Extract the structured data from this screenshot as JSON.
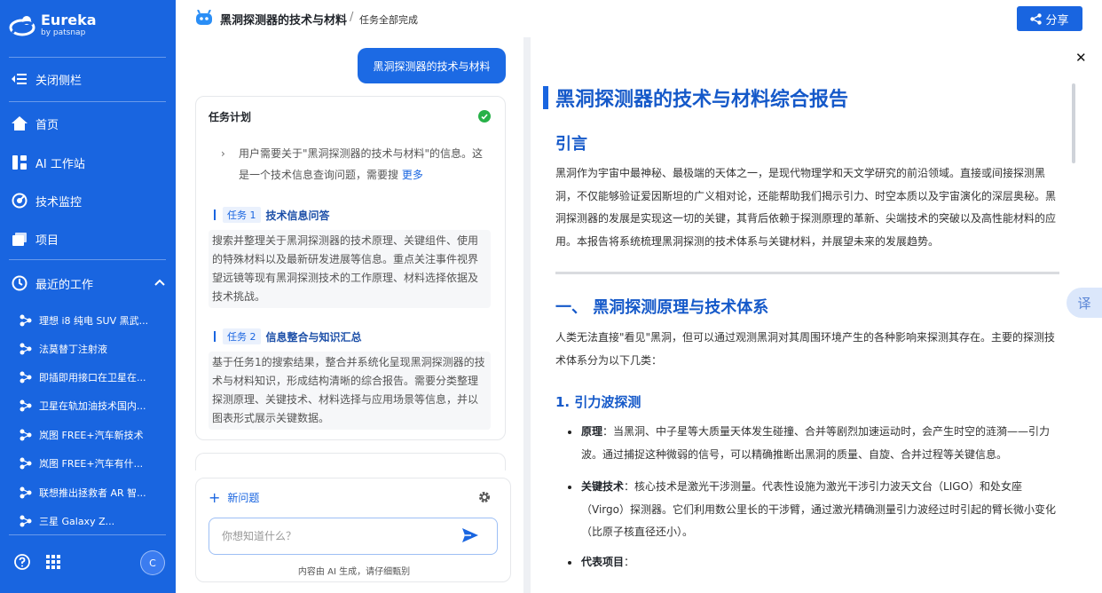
{
  "brand": {
    "name": "Eureka",
    "sub": "by patsnap"
  },
  "sidebar": {
    "collapse_label": "关闭侧栏",
    "items": [
      {
        "label": "首页",
        "icon": "home-icon"
      },
      {
        "label": "AI 工作站",
        "icon": "workstation-icon"
      },
      {
        "label": "技术监控",
        "icon": "monitor-icon"
      },
      {
        "label": "项目",
        "icon": "folder-icon"
      }
    ],
    "recent_label": "最近的工作",
    "recent": [
      "理想 i8 纯电 SUV 黑武...",
      "法莫替丁注射液",
      "即插即用接口在卫星在...",
      "卫星在轨加油技术国内...",
      "岚图 FREE+汽车新技术",
      "岚图 FREE+汽车有什...",
      "联想推出拯救者 AR 智...",
      "三星 Galaxy Z..."
    ],
    "avatar_letter": "C"
  },
  "header": {
    "title": "黑洞探测器的技术与材料",
    "separator": "/",
    "status": "任务全部完成",
    "share_label": "分享"
  },
  "chat": {
    "user_message": "黑洞探测器的技术与材料",
    "plan_title": "任务计划",
    "summary": "用户需要关于\"黑洞探测器的技术与材料\"的信息。这是一个技术信息查询问题，需要搜",
    "more": "更多",
    "tasks": [
      {
        "num": "任务 1",
        "name": "技术信息问答",
        "desc": "搜索并整理关于黑洞探测器的技术原理、关键组件、使用的特殊材料以及最新研发进展等信息。重点关注事件视界望远镜等现有黑洞探测技术的工作原理、材料选择依据及技术挑战。"
      },
      {
        "num": "任务 2",
        "name": "信息整合与知识汇总",
        "desc": "基于任务1的搜索结果，整合并系统化呈现黑洞探测器的技术与材料知识，形成结构清晰的综合报告。需要分类整理探测原理、关键技术、材料选择与应用场景等信息，并以图表形式展示关键数据。"
      }
    ],
    "new_question": "新问题",
    "input_placeholder": "你想知道什么？",
    "disclaimer": "内容由 AI 生成，请仔细甄别"
  },
  "report": {
    "title": "黑洞探测器的技术与材料综合报告",
    "intro_heading": "引言",
    "intro_text": "黑洞作为宇宙中最神秘、最极端的天体之一，是现代物理学和天文学研究的前沿领域。直接或间接探测黑洞，不仅能够验证爱因斯坦的广义相对论，还能帮助我们揭示引力、时空本质以及宇宙演化的深层奥秘。黑洞探测器的发展是实现这一切的关键，其背后依赖于探测原理的革新、尖端技术的突破以及高性能材料的应用。本报告将系统梳理黑洞探测的技术体系与关键材料，并展望未来的发展趋势。",
    "section1_heading": "一、 黑洞探测原理与技术体系",
    "section1_text": "人类无法直接\"看见\"黑洞，但可以通过观测黑洞对其周围环境产生的各种影响来探测其存在。主要的探测技术体系分为以下几类：",
    "sub1_heading": "1. 引力波探测",
    "bullets": [
      {
        "label": "原理",
        "text": "：当黑洞、中子星等大质量天体发生碰撞、合并等剧烈加速运动时，会产生时空的涟漪——引力波。通过捕捉这种微弱的信号，可以精确推断出黑洞的质量、自旋、合并过程等关键信息。"
      },
      {
        "label": "关键技术",
        "text": "：核心技术是激光干涉测量。代表性设施为激光干涉引力波天文台（LIGO）和处女座（Virgo）探测器。它们利用数公里长的干涉臂，通过激光精确测量引力波经过时引起的臂长微小变化（比原子核直径还小）。"
      },
      {
        "label": "代表项目",
        "text": "："
      }
    ],
    "translate_label": "译"
  }
}
